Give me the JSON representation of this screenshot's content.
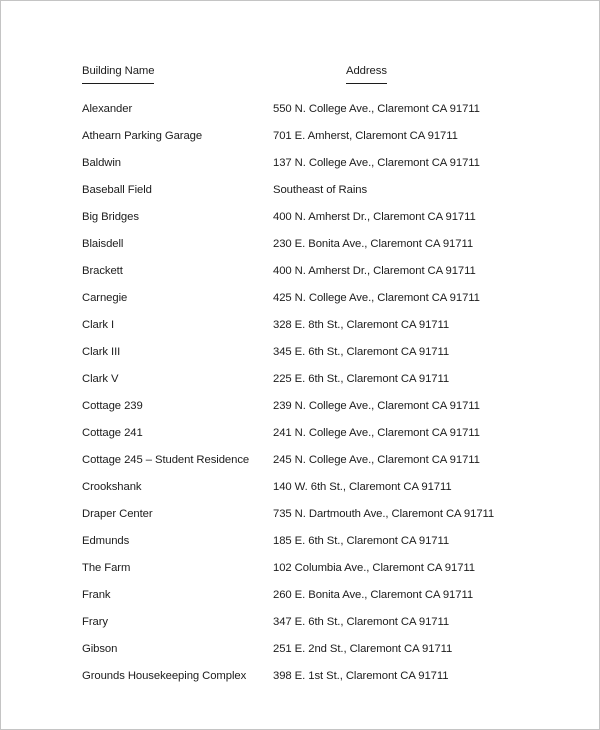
{
  "document": {
    "columns": {
      "name_header": "Building Name",
      "address_header": "Address"
    },
    "rows": [
      {
        "name": "Alexander",
        "address": "550 N. College Ave., Claremont CA 91711"
      },
      {
        "name": "Athearn Parking Garage",
        "address": "701 E. Amherst, Claremont CA 91711"
      },
      {
        "name": "Baldwin",
        "address": "137 N. College Ave., Claremont CA 91711"
      },
      {
        "name": "Baseball Field",
        "address": "Southeast of Rains"
      },
      {
        "name": "Big Bridges",
        "address": "400 N. Amherst Dr., Claremont CA 91711"
      },
      {
        "name": "Blaisdell",
        "address": "230 E. Bonita Ave., Claremont CA 91711"
      },
      {
        "name": "Brackett",
        "address": "400 N. Amherst Dr., Claremont CA 91711"
      },
      {
        "name": "Carnegie",
        "address": "425 N. College Ave., Claremont CA 91711"
      },
      {
        "name": "Clark I",
        "address": "328 E. 8th St., Claremont CA 91711"
      },
      {
        "name": "Clark III",
        "address": "345 E. 6th St., Claremont CA 91711"
      },
      {
        "name": "Clark V",
        "address": "225 E. 6th St., Claremont CA 91711"
      },
      {
        "name": "Cottage 239",
        "address": "239 N. College Ave., Claremont CA 91711"
      },
      {
        "name": "Cottage 241",
        "address": "241 N. College Ave., Claremont CA 91711"
      },
      {
        "name": "Cottage 245 – Student Residence",
        "address": "245 N. College Ave., Claremont CA 91711"
      },
      {
        "name": "Crookshank",
        "address": "140 W. 6th St., Claremont CA 91711"
      },
      {
        "name": "Draper Center",
        "address": "735 N. Dartmouth Ave., Claremont CA 91711"
      },
      {
        "name": "Edmunds",
        "address": "185 E. 6th St., Claremont CA 91711"
      },
      {
        "name": "The Farm",
        "address": "102 Columbia Ave., Claremont CA 91711"
      },
      {
        "name": "Frank",
        "address": "260 E. Bonita Ave., Claremont CA 91711"
      },
      {
        "name": "Frary",
        "address": "347 E. 6th St., Claremont CA 91711"
      },
      {
        "name": "Gibson",
        "address": "251 E. 2nd St., Claremont CA 91711"
      },
      {
        "name": "Grounds Housekeeping Complex",
        "address": "398 E. 1st St., Claremont CA 91711"
      }
    ]
  }
}
